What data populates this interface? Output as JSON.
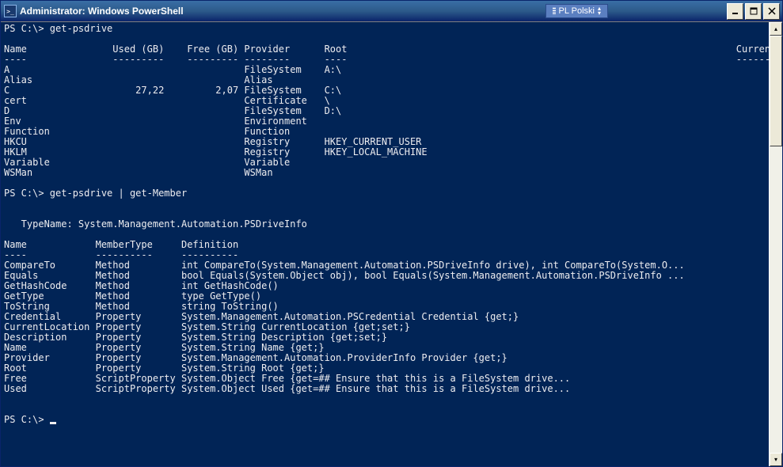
{
  "titlebar": {
    "title": "Administrator: Windows PowerShell",
    "language": "PL Polski"
  },
  "console": {
    "prompt": "PS C:\\>",
    "cmd1": "get-psdrive",
    "cmd2": "get-psdrive | get-Member",
    "table1": {
      "headers": [
        "Name",
        "Used (GB)",
        "Free (GB)",
        "Provider",
        "Root",
        "CurrentLocation"
      ],
      "dashes": [
        "----",
        "---------",
        "---------",
        "--------",
        "----",
        "---------------"
      ],
      "rows": [
        {
          "name": "A",
          "used": "",
          "free": "",
          "provider": "FileSystem",
          "root": "A:\\"
        },
        {
          "name": "Alias",
          "used": "",
          "free": "",
          "provider": "Alias",
          "root": ""
        },
        {
          "name": "C",
          "used": "27,22",
          "free": "2,07",
          "provider": "FileSystem",
          "root": "C:\\"
        },
        {
          "name": "cert",
          "used": "",
          "free": "",
          "provider": "Certificate",
          "root": "\\"
        },
        {
          "name": "D",
          "used": "",
          "free": "",
          "provider": "FileSystem",
          "root": "D:\\"
        },
        {
          "name": "Env",
          "used": "",
          "free": "",
          "provider": "Environment",
          "root": ""
        },
        {
          "name": "Function",
          "used": "",
          "free": "",
          "provider": "Function",
          "root": ""
        },
        {
          "name": "HKCU",
          "used": "",
          "free": "",
          "provider": "Registry",
          "root": "HKEY_CURRENT_USER"
        },
        {
          "name": "HKLM",
          "used": "",
          "free": "",
          "provider": "Registry",
          "root": "HKEY_LOCAL_MACHINE"
        },
        {
          "name": "Variable",
          "used": "",
          "free": "",
          "provider": "Variable",
          "root": ""
        },
        {
          "name": "WSMan",
          "used": "",
          "free": "",
          "provider": "WSMan",
          "root": ""
        }
      ]
    },
    "typename_line": "   TypeName: System.Management.Automation.PSDriveInfo",
    "table2": {
      "headers": [
        "Name",
        "MemberType",
        "Definition"
      ],
      "dashes": [
        "----",
        "----------",
        "----------"
      ],
      "rows": [
        {
          "name": "CompareTo",
          "type": "Method",
          "def": "int CompareTo(System.Management.Automation.PSDriveInfo drive), int CompareTo(System.O..."
        },
        {
          "name": "Equals",
          "type": "Method",
          "def": "bool Equals(System.Object obj), bool Equals(System.Management.Automation.PSDriveInfo ..."
        },
        {
          "name": "GetHashCode",
          "type": "Method",
          "def": "int GetHashCode()"
        },
        {
          "name": "GetType",
          "type": "Method",
          "def": "type GetType()"
        },
        {
          "name": "ToString",
          "type": "Method",
          "def": "string ToString()"
        },
        {
          "name": "Credential",
          "type": "Property",
          "def": "System.Management.Automation.PSCredential Credential {get;}"
        },
        {
          "name": "CurrentLocation",
          "type": "Property",
          "def": "System.String CurrentLocation {get;set;}"
        },
        {
          "name": "Description",
          "type": "Property",
          "def": "System.String Description {get;set;}"
        },
        {
          "name": "Name",
          "type": "Property",
          "def": "System.String Name {get;}"
        },
        {
          "name": "Provider",
          "type": "Property",
          "def": "System.Management.Automation.ProviderInfo Provider {get;}"
        },
        {
          "name": "Root",
          "type": "Property",
          "def": "System.String Root {get;}"
        },
        {
          "name": "Free",
          "type": "ScriptProperty",
          "def": "System.Object Free {get=## Ensure that this is a FileSystem drive..."
        },
        {
          "name": "Used",
          "type": "ScriptProperty",
          "def": "System.Object Used {get=## Ensure that this is a FileSystem drive..."
        }
      ]
    }
  }
}
